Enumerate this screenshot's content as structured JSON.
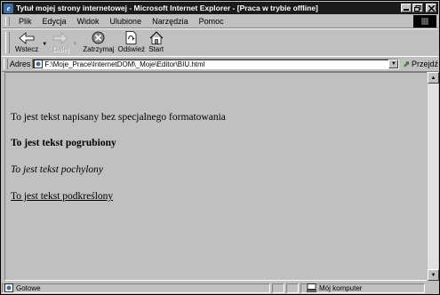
{
  "window": {
    "title": "Tytuł mojej strony internetowej - Microsoft Internet Explorer - [Praca w trybie offline]"
  },
  "menu": [
    "Plik",
    "Edycja",
    "Widok",
    "Ulubione",
    "Narzędzia",
    "Pomoc"
  ],
  "toolbar": {
    "back_label": "Wstecz",
    "forward_label": "Dalej",
    "stop_label": "Zatrzymaj",
    "refresh_label": "Odśwież",
    "home_label": "Start"
  },
  "address": {
    "label": "Adres",
    "value": "F:\\Moje_Prace\\InternetDOM\\_Moje\\Editor\\BIU.html",
    "go_label": "Przejdź"
  },
  "page": {
    "normal": "To jest tekst napisany bez specjalnego formatowania",
    "bold": "To jest tekst pogrubiony",
    "italic": "To jest tekst pochylony",
    "underline": "To jest tekst podkreślony"
  },
  "status": {
    "text": "Gotowe",
    "zone": "Mój komputer"
  }
}
